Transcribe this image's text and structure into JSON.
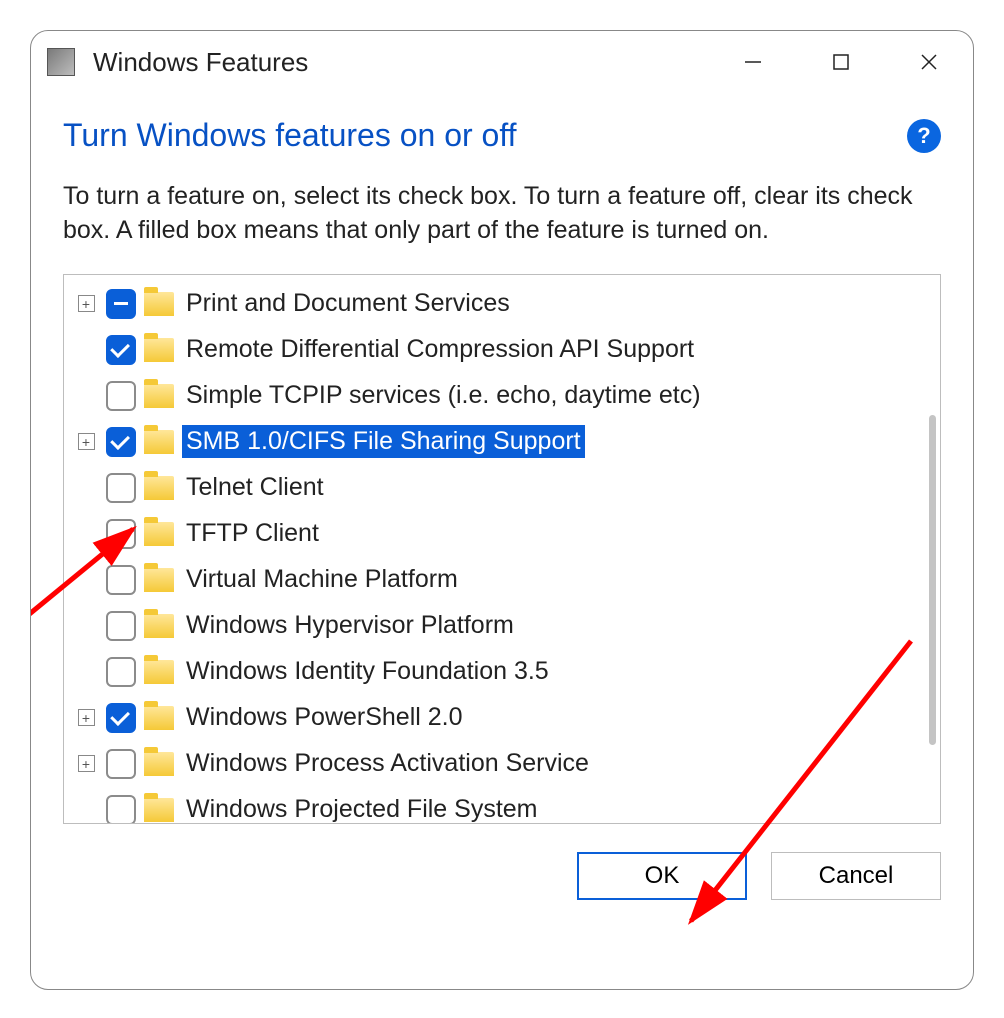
{
  "window": {
    "title": "Windows Features",
    "minimize_icon": "minimize-icon",
    "maximize_icon": "maximize-icon",
    "close_icon": "close-icon"
  },
  "heading": "Turn Windows features on or off",
  "help_icon": "?",
  "description": "To turn a feature on, select its check box. To turn a feature off, clear its check box. A filled box means that only part of the feature is turned on.",
  "features": [
    {
      "label": "Print and Document Services",
      "state": "partial",
      "expandable": true,
      "selected": false
    },
    {
      "label": "Remote Differential Compression API Support",
      "state": "checked",
      "expandable": false,
      "selected": false
    },
    {
      "label": "Simple TCPIP services (i.e. echo, daytime etc)",
      "state": "unchecked",
      "expandable": false,
      "selected": false
    },
    {
      "label": "SMB 1.0/CIFS File Sharing Support",
      "state": "checked",
      "expandable": true,
      "selected": true
    },
    {
      "label": "Telnet Client",
      "state": "unchecked",
      "expandable": false,
      "selected": false
    },
    {
      "label": "TFTP Client",
      "state": "unchecked",
      "expandable": false,
      "selected": false
    },
    {
      "label": "Virtual Machine Platform",
      "state": "unchecked",
      "expandable": false,
      "selected": false
    },
    {
      "label": "Windows Hypervisor Platform",
      "state": "unchecked",
      "expandable": false,
      "selected": false
    },
    {
      "label": "Windows Identity Foundation 3.5",
      "state": "unchecked",
      "expandable": false,
      "selected": false
    },
    {
      "label": "Windows PowerShell 2.0",
      "state": "checked",
      "expandable": true,
      "selected": false
    },
    {
      "label": "Windows Process Activation Service",
      "state": "unchecked",
      "expandable": true,
      "selected": false
    },
    {
      "label": "Windows Projected File System",
      "state": "unchecked",
      "expandable": false,
      "selected": false
    }
  ],
  "buttons": {
    "ok": "OK",
    "cancel": "Cancel"
  },
  "colors": {
    "accent": "#0a5fd8",
    "heading": "#0751c4",
    "folder": "#f5c937",
    "annotation_arrow": "#ff0000"
  }
}
